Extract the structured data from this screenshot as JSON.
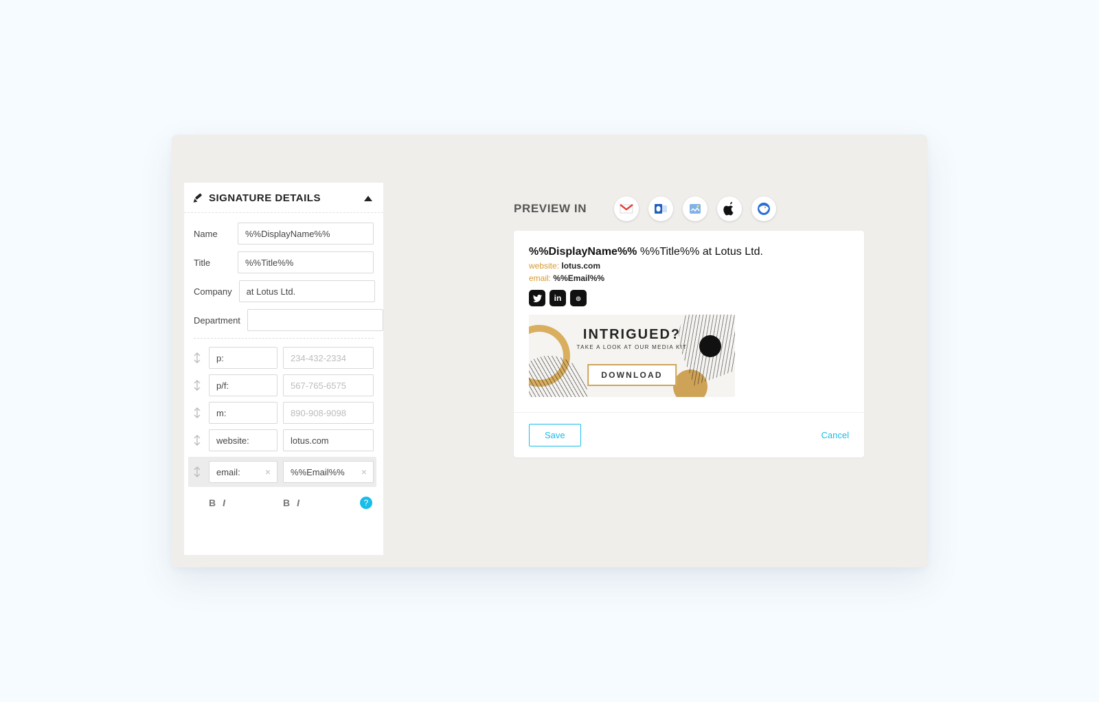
{
  "panel": {
    "title": "SIGNATURE DETAILS",
    "fields": {
      "name": {
        "label": "Name",
        "value": "%%DisplayName%%"
      },
      "title": {
        "label": "Title",
        "value": "%%Title%%"
      },
      "company": {
        "label": "Company",
        "value": "at Lotus Ltd."
      },
      "department": {
        "label": "Department",
        "value": ""
      }
    },
    "contactRows": [
      {
        "key": "p:",
        "value": "",
        "placeholder_key": "p:",
        "placeholder_val": "234-432-2334",
        "clear": false
      },
      {
        "key": "p/f:",
        "value": "",
        "placeholder_key": "p/f:",
        "placeholder_val": "567-765-6575",
        "clear": false
      },
      {
        "key": "m:",
        "value": "",
        "placeholder_key": "m:",
        "placeholder_val": "890-908-9098",
        "clear": false
      },
      {
        "key": "website:",
        "value": "lotus.com",
        "placeholder_key": "",
        "placeholder_val": "",
        "clear": false
      },
      {
        "key": "email:",
        "value": "%%Email%%",
        "placeholder_key": "",
        "placeholder_val": "",
        "clear": true
      }
    ],
    "format": {
      "bold": "B",
      "italic": "I",
      "help": "?"
    }
  },
  "preview": {
    "heading": "PREVIEW IN",
    "clients": [
      "gmail",
      "outlook",
      "postbox",
      "applemail",
      "thunderbird"
    ],
    "sig": {
      "display_name": "%%DisplayName%%",
      "title_suffix": "%%Title%% at Lotus Ltd.",
      "website_label": "website:",
      "website_value": "lotus.com",
      "email_label": "email:",
      "email_value": "%%Email%%"
    },
    "banner": {
      "headline": "INTRIGUED?",
      "subline": "TAKE A LOOK AT OUR MEDIA KIT",
      "cta": "DOWNLOAD"
    },
    "actions": {
      "save": "Save",
      "cancel": "Cancel"
    }
  }
}
